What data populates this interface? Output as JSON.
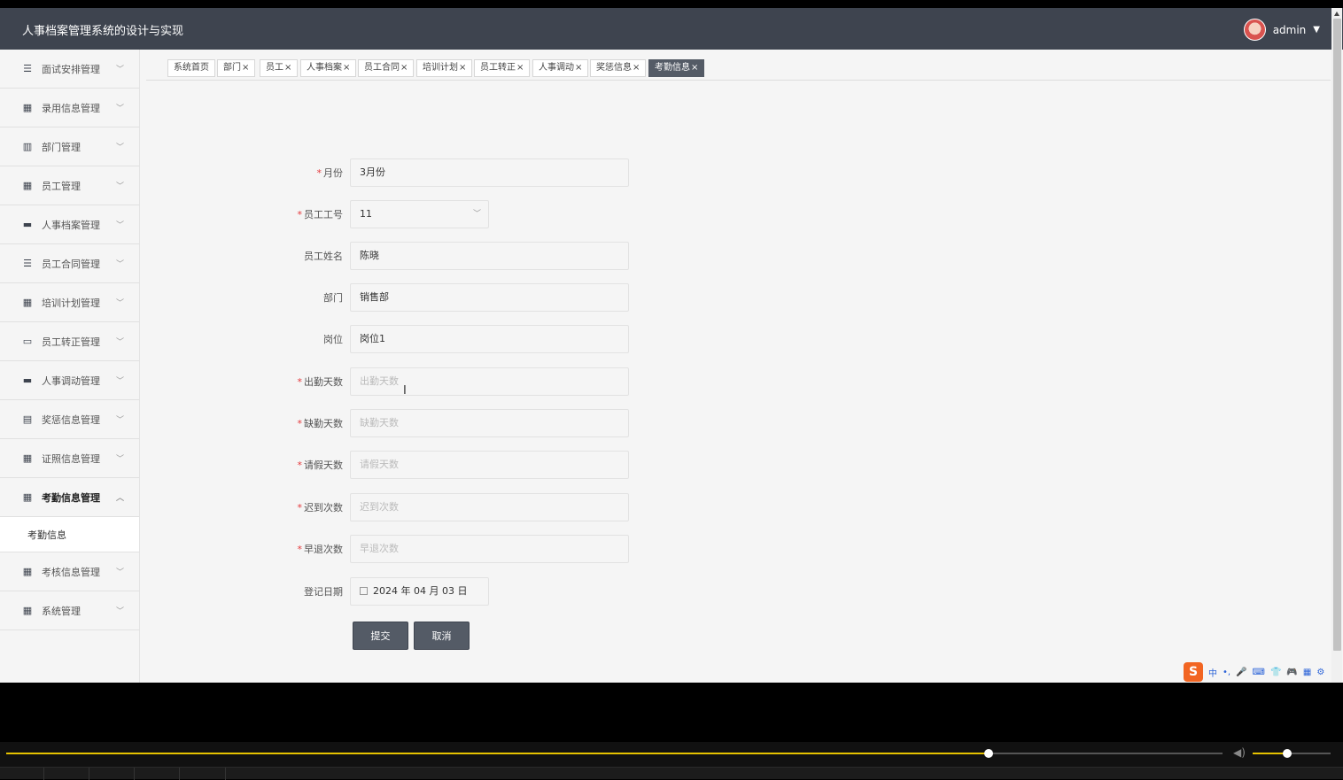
{
  "app": {
    "title": "人事档案管理系统的设计与实现",
    "user": "admin"
  },
  "sidebar": {
    "items": [
      {
        "label": "面试安排管理",
        "icon": "list-icon",
        "glyph": "☰"
      },
      {
        "label": "录用信息管理",
        "icon": "grid-icon",
        "glyph": "▦"
      },
      {
        "label": "部门管理",
        "icon": "building-icon",
        "glyph": "▥"
      },
      {
        "label": "员工管理",
        "icon": "table-icon",
        "glyph": "▦"
      },
      {
        "label": "人事档案管理",
        "icon": "briefcase-icon",
        "glyph": "▬"
      },
      {
        "label": "员工合同管理",
        "icon": "sliders-icon",
        "glyph": "☰"
      },
      {
        "label": "培训计划管理",
        "icon": "grid-icon",
        "glyph": "▦"
      },
      {
        "label": "员工转正管理",
        "icon": "comment-icon",
        "glyph": "▭"
      },
      {
        "label": "人事调动管理",
        "icon": "ticket-icon",
        "glyph": "▬"
      },
      {
        "label": "奖惩信息管理",
        "icon": "clipboard-icon",
        "glyph": "▤"
      },
      {
        "label": "证照信息管理",
        "icon": "grid-icon",
        "glyph": "▦"
      },
      {
        "label": "考勤信息管理",
        "icon": "grid-icon",
        "glyph": "▦"
      },
      {
        "label": "考核信息管理",
        "icon": "grid-icon",
        "glyph": "▦"
      },
      {
        "label": "系统管理",
        "icon": "grid-icon",
        "glyph": "▦"
      }
    ],
    "submenu": {
      "label": "考勤信息"
    }
  },
  "tabs": [
    {
      "label": "系统首页"
    },
    {
      "label": "部门",
      "close": "×"
    },
    {
      "label": "员工",
      "close": "×"
    },
    {
      "label": "人事档案",
      "close": "×"
    },
    {
      "label": "员工合同",
      "close": "×"
    },
    {
      "label": "培训计划",
      "close": "×"
    },
    {
      "label": "员工转正",
      "close": "×"
    },
    {
      "label": "人事调动",
      "close": "×"
    },
    {
      "label": "奖惩信息",
      "close": "×"
    },
    {
      "label": "考勤信息",
      "close": "×"
    }
  ],
  "form": {
    "month": {
      "label": "月份",
      "required": "*",
      "value": "3月份"
    },
    "employee_no": {
      "label": "员工工号",
      "required": "*",
      "value": "11"
    },
    "employee_name": {
      "label": "员工姓名",
      "value": "陈晓"
    },
    "department": {
      "label": "部门",
      "value": "销售部"
    },
    "position": {
      "label": "岗位",
      "value": "岗位1"
    },
    "attendance_days": {
      "label": "出勤天数",
      "required": "*",
      "placeholder": "出勤天数"
    },
    "absence_days": {
      "label": "缺勤天数",
      "required": "*",
      "placeholder": "缺勤天数"
    },
    "leave_days": {
      "label": "请假天数",
      "required": "*",
      "placeholder": "请假天数"
    },
    "late_count": {
      "label": "迟到次数",
      "required": "*",
      "placeholder": "迟到次数"
    },
    "early_leave_count": {
      "label": "早退次数",
      "required": "*",
      "placeholder": "早退次数"
    },
    "register_date": {
      "label": "登记日期",
      "value": "2024 年 04 月 03 日"
    },
    "submit_label": "提交",
    "cancel_label": "取消"
  },
  "ime": {
    "lang": "中",
    "punct": "•,",
    "tools": [
      "🎤",
      "⌨",
      "👕",
      "🎮",
      "▦",
      "⚙"
    ]
  },
  "player": {
    "progress": 0.808,
    "volume": 0.44
  }
}
